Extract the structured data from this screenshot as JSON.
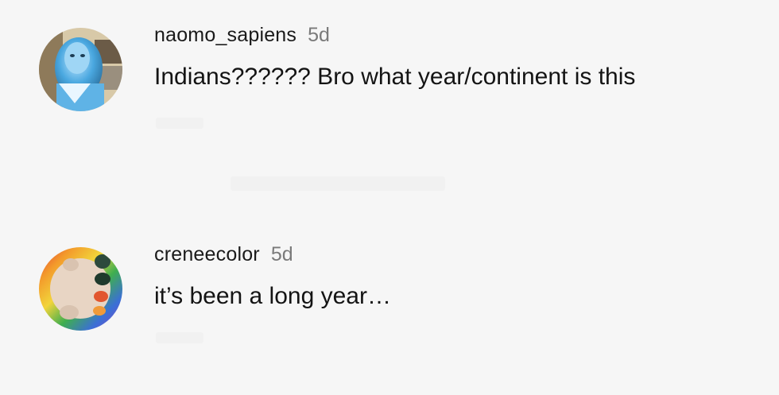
{
  "comments": [
    {
      "username": "naomo_sapiens",
      "timestamp": "5d",
      "text": "Indians?????? Bro what year/continent is this",
      "avatar_icon": "profile-photo-avatar"
    },
    {
      "username": "creneecolor",
      "timestamp": "5d",
      "text": "it’s been a long year…",
      "avatar_icon": "profile-photo-avatar"
    }
  ],
  "colors": {
    "background": "#f6f6f6",
    "username": "#1a1a1a",
    "timestamp": "#7a7a7a",
    "text": "#141414"
  }
}
